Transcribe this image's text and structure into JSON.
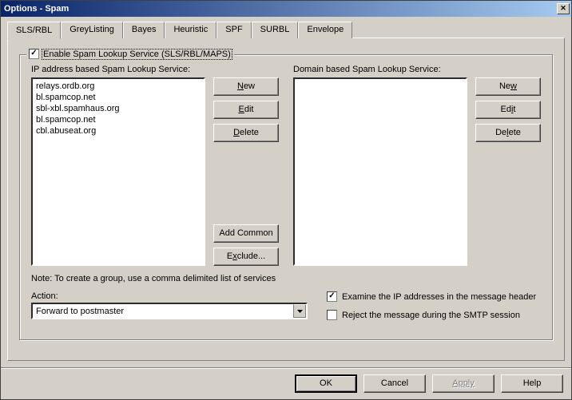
{
  "window": {
    "title": "Options - Spam"
  },
  "tabs": [
    "SLS/RBL",
    "GreyListing",
    "Bayes",
    "Heuristic",
    "SPF",
    "SURBL",
    "Envelope"
  ],
  "active_tab": 0,
  "enable": {
    "checked": true,
    "label": "Enable Spam Lookup Service (SLS/RBL/MAPS)"
  },
  "ip_section": {
    "label": "IP address based Spam Lookup Service:",
    "items": [
      "relays.ordb.org",
      "bl.spamcop.net",
      "sbl-xbl.spamhaus.org",
      "bl.spamcop.net",
      "cbl.abuseat.org"
    ],
    "buttons": {
      "new": "New",
      "edit": "Edit",
      "delete": "Delete",
      "add_common": "Add Common",
      "exclude": "Exclude..."
    }
  },
  "domain_section": {
    "label": "Domain based Spam Lookup Service:",
    "items": [],
    "buttons": {
      "new": "New",
      "edit": "Edit",
      "delete": "Delete"
    }
  },
  "note": "Note: To create a group, use a comma delimited list of services",
  "action": {
    "label": "Action:",
    "value": "Forward to postmaster"
  },
  "examine": {
    "checked": true,
    "label": "Examine the IP addresses in the message header"
  },
  "reject": {
    "checked": false,
    "label": "Reject the message during the SMTP session"
  },
  "footer": {
    "ok": "OK",
    "cancel": "Cancel",
    "apply": "Apply",
    "help": "Help"
  }
}
